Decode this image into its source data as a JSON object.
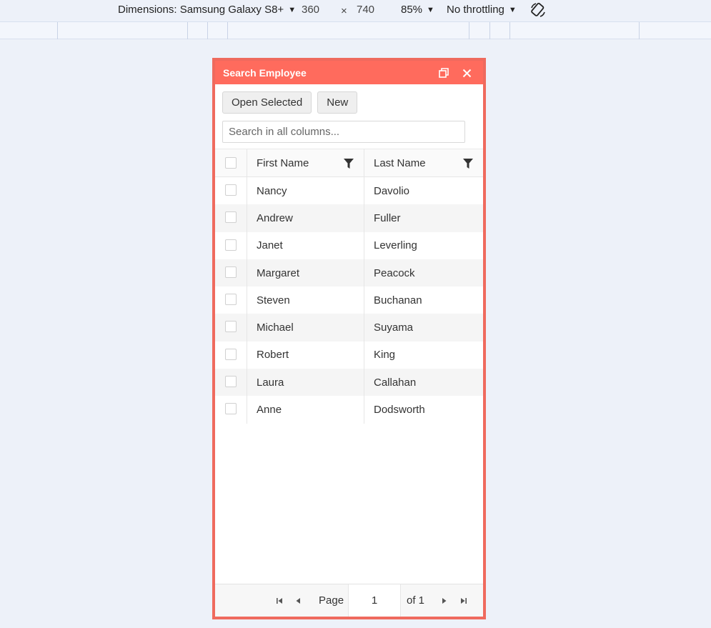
{
  "devtools": {
    "dimensions_label": "Dimensions: Samsung Galaxy S8+",
    "width": "360",
    "times": "×",
    "height": "740",
    "zoom": "85%",
    "throttling": "No throttling"
  },
  "dialog": {
    "title": "Search Employee",
    "toolbar": {
      "open_selected": "Open Selected",
      "new": "New"
    },
    "search": {
      "placeholder": "Search in all columns..."
    },
    "grid": {
      "columns": [
        "First Name",
        "Last Name"
      ],
      "rows": [
        {
          "first": "Nancy",
          "last": "Davolio"
        },
        {
          "first": "Andrew",
          "last": "Fuller"
        },
        {
          "first": "Janet",
          "last": "Leverling"
        },
        {
          "first": "Margaret",
          "last": "Peacock"
        },
        {
          "first": "Steven",
          "last": "Buchanan"
        },
        {
          "first": "Michael",
          "last": "Suyama"
        },
        {
          "first": "Robert",
          "last": "King"
        },
        {
          "first": "Laura",
          "last": "Callahan"
        },
        {
          "first": "Anne",
          "last": "Dodsworth"
        }
      ]
    },
    "pager": {
      "page_label": "Page",
      "current_page": "1",
      "of_label": "of 1"
    }
  },
  "colors": {
    "header": "#ff6b5d",
    "border": "#ef6a5e",
    "background": "#edf1f9"
  },
  "icons": {
    "restore": "restore-icon",
    "close": "close-icon",
    "filter": "filter-icon",
    "rotate": "rotate-icon"
  }
}
